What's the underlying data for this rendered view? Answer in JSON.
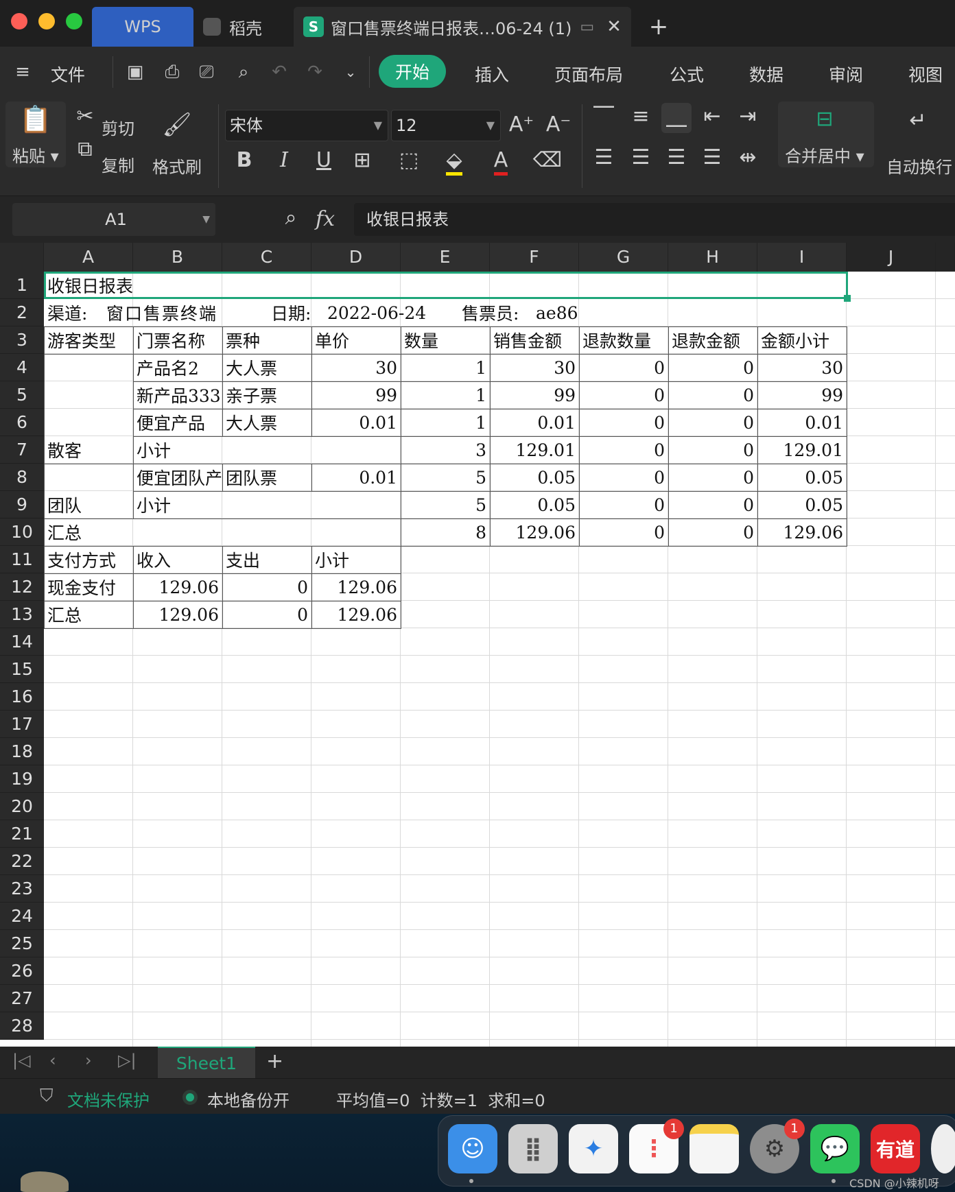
{
  "titlebar": {
    "tabs": [
      {
        "label": "WPS",
        "active": false,
        "color": "#2e5fbf"
      },
      {
        "label": "稻壳",
        "active": false
      },
      {
        "label": "窗口售票终端日报表…06-24 (1)",
        "active": true,
        "icon_letter": "S",
        "icon_color": "#1fa67a"
      }
    ],
    "new_tab_label": "+",
    "close_label": "✕"
  },
  "menu": {
    "file_label": "文件",
    "items": [
      "开始",
      "插入",
      "页面布局",
      "公式",
      "数据",
      "审阅",
      "视图"
    ],
    "active": "开始",
    "accent": "#1fa67a"
  },
  "ribbon": {
    "paste_label": "粘贴",
    "cut_label": "剪切",
    "copy_label": "复制",
    "format_painter_label": "格式刷",
    "font_name": "宋体",
    "font_size": "12",
    "merge_label": "合并居中",
    "wrap_label": "自动换行"
  },
  "formula_bar": {
    "cell_ref": "A1",
    "fx_label": "fx",
    "content": "收银日报表"
  },
  "columns": [
    "A",
    "B",
    "C",
    "D",
    "E",
    "F",
    "G",
    "H",
    "I",
    "J"
  ],
  "rows": [
    "1",
    "2",
    "3",
    "4",
    "5",
    "6",
    "7",
    "8",
    "9",
    "10",
    "11",
    "12",
    "13",
    "14",
    "15",
    "16",
    "17",
    "18",
    "19",
    "20",
    "21",
    "22",
    "23",
    "24",
    "25",
    "26",
    "27",
    "28"
  ],
  "sheet": {
    "title": "收银日报表",
    "r2_channel_label": "渠道:",
    "r2_channel": "窗口售票终端",
    "r2_date_label": "日期:",
    "r2_date": "2022-06-24",
    "r2_seller_label": "售票员:",
    "r2_seller": "ae86",
    "header": [
      "游客类型",
      "门票名称",
      "票种",
      "单价",
      "数量",
      "销售金额",
      "退款数量",
      "退款金额",
      "金额小计"
    ],
    "r4": [
      "产品名2",
      "大人票",
      "30",
      "1",
      "30",
      "0",
      "0",
      "30"
    ],
    "r5": [
      "新产品333",
      "亲子票",
      "99",
      "1",
      "99",
      "0",
      "0",
      "99"
    ],
    "r6": [
      "便宜产品",
      "大人票",
      "0.01",
      "1",
      "0.01",
      "0",
      "0",
      "0.01"
    ],
    "r7": [
      "散客",
      "小计",
      "3",
      "129.01",
      "0",
      "0",
      "129.01"
    ],
    "r8": [
      "便宜团队产品",
      "团队票",
      "0.01",
      "5",
      "0.05",
      "0",
      "0",
      "0.05"
    ],
    "r9": [
      "团队",
      "小计",
      "5",
      "0.05",
      "0",
      "0",
      "0.05"
    ],
    "r10": [
      "汇总",
      "8",
      "129.06",
      "0",
      "0",
      "129.06"
    ],
    "pay_header": [
      "支付方式",
      "收入",
      "支出",
      "小计"
    ],
    "r12": [
      "现金支付",
      "129.06",
      "0",
      "129.06"
    ],
    "r13": [
      "汇总",
      "129.06",
      "0",
      "129.06"
    ]
  },
  "sheet_tabs": {
    "active": "Sheet1",
    "add_label": "+"
  },
  "status": {
    "protect": "文档未保护",
    "backup": "本地备份开",
    "stats": "平均值=0  计数=1  求和=0"
  },
  "dock": {
    "apps": [
      {
        "name": "finder-icon",
        "color": "#3b8fe8"
      },
      {
        "name": "launchpad-icon",
        "color": "#d0d0d0"
      },
      {
        "name": "safari-icon",
        "color": "#f2f2f2"
      },
      {
        "name": "reminders-icon",
        "color": "#fafafa",
        "badge": "1"
      },
      {
        "name": "notes-icon",
        "color": "#f5f5f5"
      },
      {
        "name": "system-preferences-icon",
        "color": "#9a9a9a",
        "badge": "1"
      },
      {
        "name": "wechat-icon",
        "color": "#2dc35c"
      },
      {
        "name": "youdao-icon",
        "color": "#e1262a",
        "label": "有道"
      },
      {
        "name": "chrome-icon",
        "color": "#eeeeee"
      }
    ],
    "watermark": "CSDN @小辣机呀"
  }
}
